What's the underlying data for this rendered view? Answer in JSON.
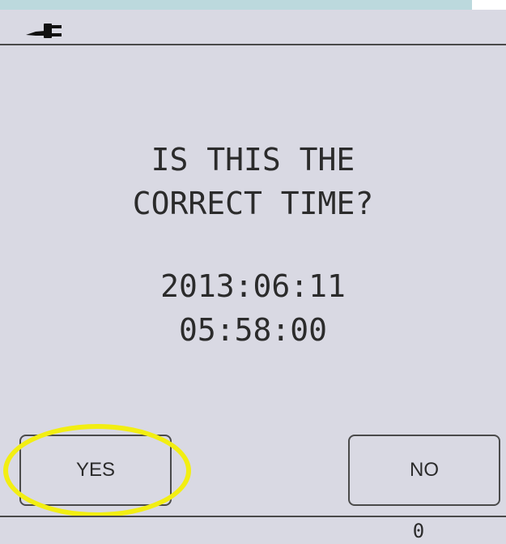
{
  "status_bar": {
    "icon": "power-plug-icon"
  },
  "prompt": {
    "line1": "IS THIS THE",
    "line2": "CORRECT TIME?"
  },
  "datetime": {
    "date": "2013:06:11",
    "time": "05:58:00"
  },
  "buttons": {
    "yes_label": "YES",
    "no_label": "NO"
  },
  "footer": {
    "counter": "0"
  },
  "colors": {
    "screen_background": "#d9d9e3",
    "top_strip": "#bcd9dd",
    "highlight": "#f2ee12",
    "text": "#2b2b2b"
  }
}
